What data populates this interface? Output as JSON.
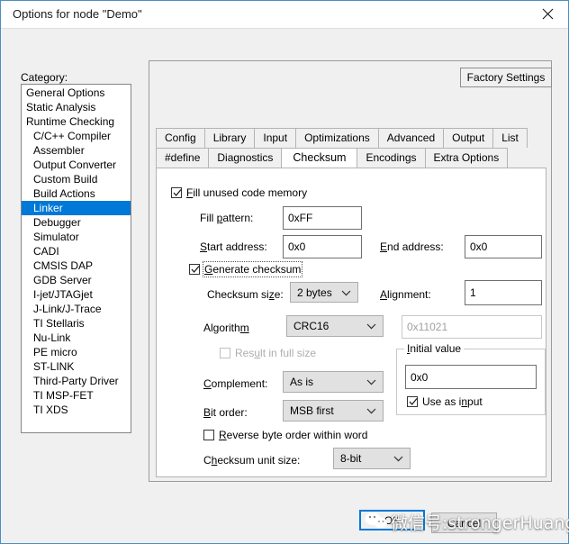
{
  "window": {
    "title": "Options for node \"Demo\"",
    "close_icon": "close-icon"
  },
  "category": {
    "label": "Category:",
    "selected": "Linker",
    "items": [
      {
        "label": "General Options",
        "indent": false
      },
      {
        "label": "Static Analysis",
        "indent": false
      },
      {
        "label": "Runtime Checking",
        "indent": false
      },
      {
        "label": "C/C++ Compiler",
        "indent": true
      },
      {
        "label": "Assembler",
        "indent": true
      },
      {
        "label": "Output Converter",
        "indent": true
      },
      {
        "label": "Custom Build",
        "indent": true
      },
      {
        "label": "Build Actions",
        "indent": true
      },
      {
        "label": "Linker",
        "indent": true
      },
      {
        "label": "Debugger",
        "indent": true
      },
      {
        "label": "Simulator",
        "indent": true
      },
      {
        "label": "CADI",
        "indent": true
      },
      {
        "label": "CMSIS DAP",
        "indent": true
      },
      {
        "label": "GDB Server",
        "indent": true
      },
      {
        "label": "I-jet/JTAGjet",
        "indent": true
      },
      {
        "label": "J-Link/J-Trace",
        "indent": true
      },
      {
        "label": "TI Stellaris",
        "indent": true
      },
      {
        "label": "Nu-Link",
        "indent": true
      },
      {
        "label": "PE micro",
        "indent": true
      },
      {
        "label": "ST-LINK",
        "indent": true
      },
      {
        "label": "Third-Party Driver",
        "indent": true
      },
      {
        "label": "TI MSP-FET",
        "indent": true
      },
      {
        "label": "TI XDS",
        "indent": true
      }
    ]
  },
  "factory_settings": {
    "label": "Factory Settings"
  },
  "tabs": {
    "active": "Checksum",
    "row1": [
      "Config",
      "Library",
      "Input",
      "Optimizations",
      "Advanced",
      "Output",
      "List"
    ],
    "row2": [
      "#define",
      "Diagnostics",
      "Checksum",
      "Encodings",
      "Extra Options"
    ]
  },
  "checksum": {
    "fill_unused": {
      "label": "Fill unused code memory",
      "checked": true
    },
    "fill_pattern": {
      "label": "Fill pattern:",
      "value": "0xFF"
    },
    "start_address": {
      "label": "Start address:",
      "value": "0x0"
    },
    "end_address": {
      "label": "End address:",
      "value": "0x0"
    },
    "generate_checksum": {
      "label": "Generate checksum",
      "checked": true
    },
    "checksum_size": {
      "label": "Checksum size:",
      "value": "2 bytes"
    },
    "alignment": {
      "label": "Alignment:",
      "value": "1"
    },
    "algorithm": {
      "label": "Algorithm",
      "value": "CRC16"
    },
    "polynomial": {
      "value": "0x11021"
    },
    "result_full_size": {
      "label": "Result in full size",
      "checked": false
    },
    "complement": {
      "label": "Complement:",
      "value": "As is"
    },
    "bit_order": {
      "label": "Bit order:",
      "value": "MSB first"
    },
    "reverse_byte_order": {
      "label": "Reverse byte order within word",
      "checked": false
    },
    "unit_size": {
      "label": "Checksum unit size:",
      "value": "8-bit"
    },
    "initial_value": {
      "group_label": "Initial value",
      "value": "0x0",
      "use_as_input": {
        "label": "Use as input",
        "checked": true
      }
    }
  },
  "dialog_buttons": {
    "ok": "OK",
    "cancel": "Cancel"
  },
  "watermark": {
    "text": "微信号:strongerHuang"
  },
  "colors": {
    "accent": "#0078d7",
    "frame": "#9b9b9b",
    "panel": "#f0f0f0"
  }
}
